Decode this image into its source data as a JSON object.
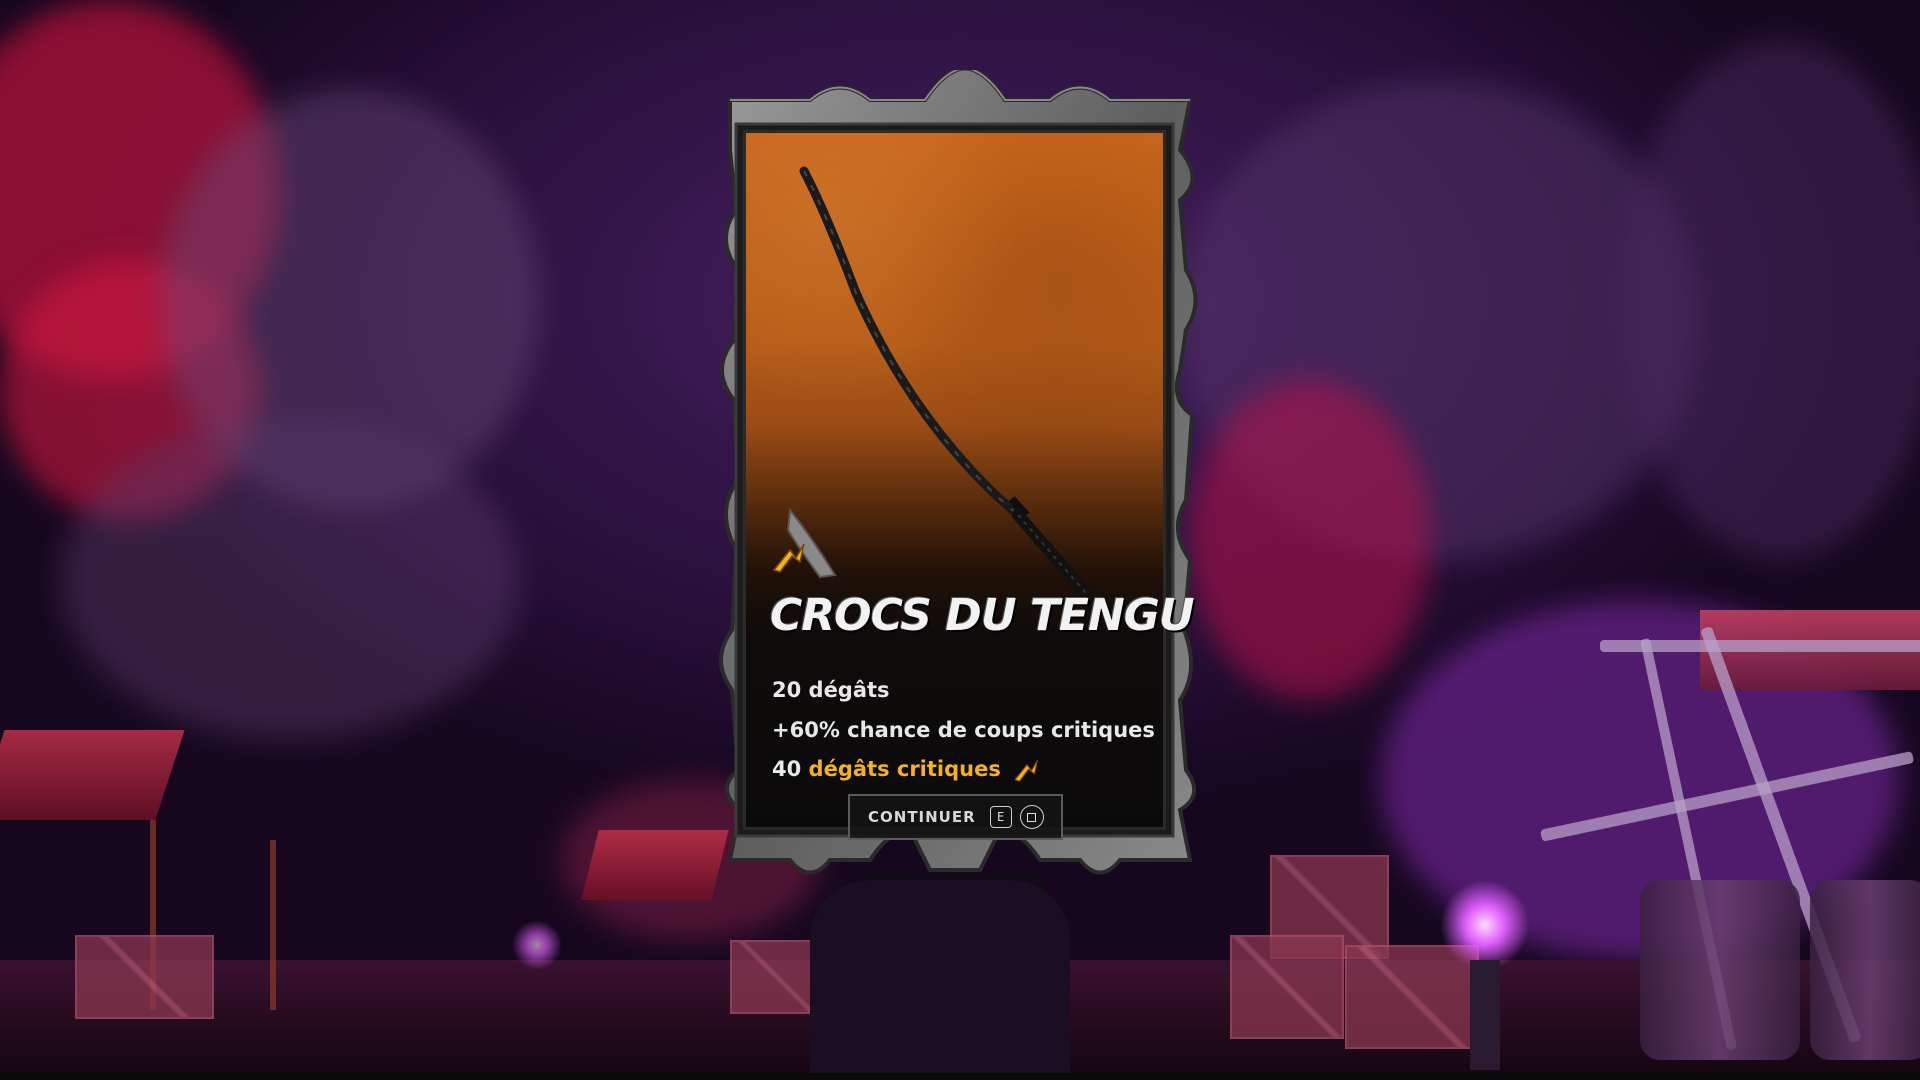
{
  "weapon": {
    "name": "CROCS DU TENGU",
    "stats": {
      "damage": "20 dégâts",
      "crit_chance": "+60% chance de coups critiques",
      "crit_damage_value": "40",
      "crit_damage_label": "dégâts critiques"
    },
    "rarity_icon": "rarity-chevron-icon",
    "class_icon": "blade-class-icon"
  },
  "continue_button": {
    "label": "CONTINUER",
    "keyboard_key": "E",
    "gamepad_icon": "square-button-icon"
  },
  "colors": {
    "card_top": "#c8661c",
    "card_bottom": "#0b0a0a",
    "highlight": "#f5b21a",
    "background": "#34164a"
  }
}
